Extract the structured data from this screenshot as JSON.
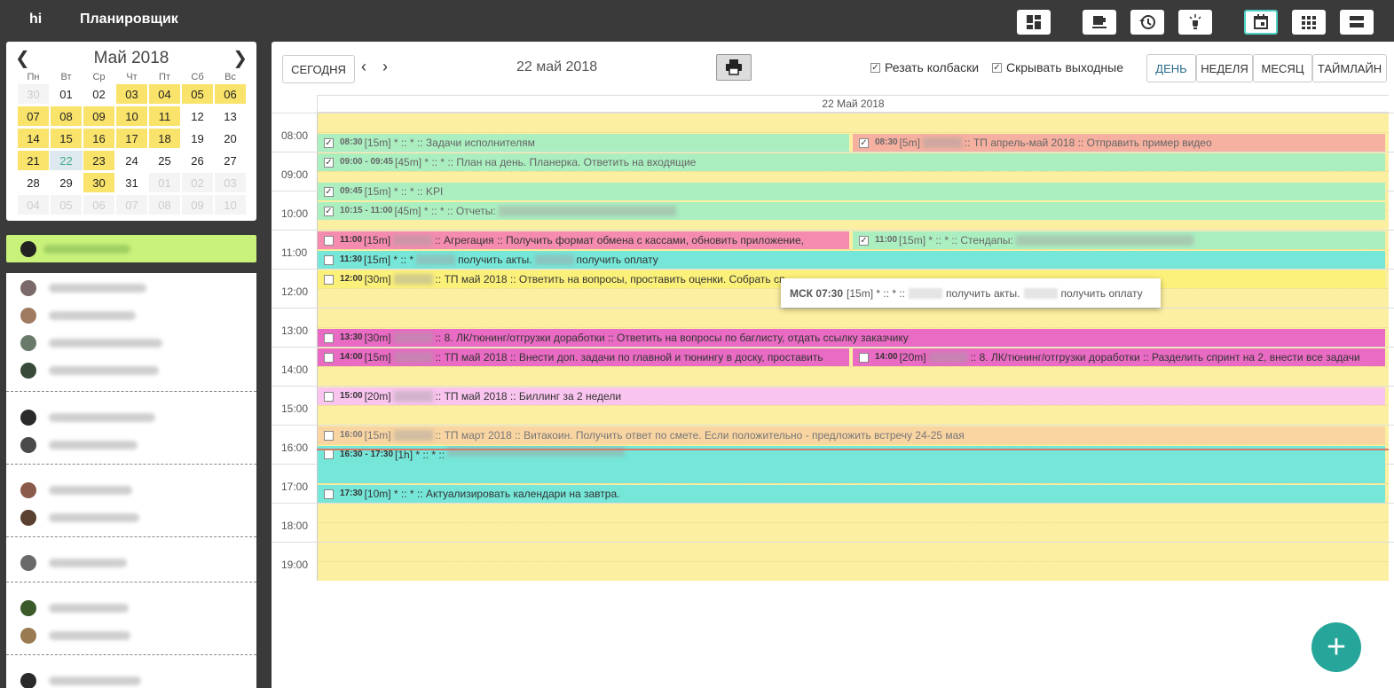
{
  "topbar": {
    "brand": "hi",
    "title": "Планировщик",
    "buttons": [
      {
        "name": "dashboard-icon",
        "glyph": "dashboard"
      },
      {
        "name": "coffee-icon",
        "glyph": "coffee"
      },
      {
        "name": "history-icon",
        "glyph": "history"
      },
      {
        "name": "lightbulb-icon",
        "glyph": "light"
      },
      {
        "name": "calendar-day-icon",
        "glyph": "calendar",
        "active": true
      },
      {
        "name": "grid-view-icon",
        "glyph": "grid"
      },
      {
        "name": "list-view-icon",
        "glyph": "list"
      }
    ]
  },
  "minical": {
    "month": "Май 2018",
    "weekdays": [
      "Пн",
      "Вт",
      "Ср",
      "Чт",
      "Пт",
      "Сб",
      "Вс"
    ],
    "weeks": [
      [
        {
          "d": "30",
          "t": "other"
        },
        {
          "d": "01",
          "t": ""
        },
        {
          "d": "02",
          "t": ""
        },
        {
          "d": "03",
          "t": "hl"
        },
        {
          "d": "04",
          "t": "hl"
        },
        {
          "d": "05",
          "t": "hl"
        },
        {
          "d": "06",
          "t": "hl"
        }
      ],
      [
        {
          "d": "07",
          "t": "hl"
        },
        {
          "d": "08",
          "t": "hl"
        },
        {
          "d": "09",
          "t": "hl"
        },
        {
          "d": "10",
          "t": "hl"
        },
        {
          "d": "11",
          "t": "hl"
        },
        {
          "d": "12",
          "t": ""
        },
        {
          "d": "13",
          "t": ""
        }
      ],
      [
        {
          "d": "14",
          "t": "hl"
        },
        {
          "d": "15",
          "t": "hl"
        },
        {
          "d": "16",
          "t": "hl"
        },
        {
          "d": "17",
          "t": "hl"
        },
        {
          "d": "18",
          "t": "hl"
        },
        {
          "d": "19",
          "t": ""
        },
        {
          "d": "20",
          "t": ""
        }
      ],
      [
        {
          "d": "21",
          "t": "hl"
        },
        {
          "d": "22",
          "t": "today"
        },
        {
          "d": "23",
          "t": "hl"
        },
        {
          "d": "24",
          "t": ""
        },
        {
          "d": "25",
          "t": ""
        },
        {
          "d": "26",
          "t": ""
        },
        {
          "d": "27",
          "t": ""
        }
      ],
      [
        {
          "d": "28",
          "t": ""
        },
        {
          "d": "29",
          "t": ""
        },
        {
          "d": "30",
          "t": "hl"
        },
        {
          "d": "31",
          "t": ""
        },
        {
          "d": "01",
          "t": "other"
        },
        {
          "d": "02",
          "t": "other"
        },
        {
          "d": "03",
          "t": "other"
        }
      ],
      [
        {
          "d": "04",
          "t": "other"
        },
        {
          "d": "05",
          "t": "other"
        },
        {
          "d": "06",
          "t": "other"
        },
        {
          "d": "07",
          "t": "other"
        },
        {
          "d": "08",
          "t": "other"
        },
        {
          "d": "09",
          "t": "other"
        },
        {
          "d": "10",
          "t": "other"
        }
      ]
    ]
  },
  "toolbar": {
    "today_label": "СЕГОДНЯ",
    "current_date": "22 май 2018",
    "cut_sausages_label": "Резать колбаски",
    "hide_weekends_label": "Скрывать выходные",
    "view_day": "ДЕНЬ",
    "view_week": "НЕДЕЛЯ",
    "view_month": "МЕСЯЦ",
    "view_timeline": "ТАЙМЛАЙН"
  },
  "calendar": {
    "column_header": "22 Май 2018",
    "hours": [
      "08:00",
      "09:00",
      "10:00",
      "11:00",
      "12:00",
      "13:00",
      "14:00",
      "15:00",
      "16:00",
      "17:00",
      "18:00",
      "19:00"
    ]
  },
  "events": [
    {
      "id": "e1",
      "done": true,
      "time": "08:30",
      "text": "[15m] * :: * :: Задачи исполнителям",
      "blur": false,
      "color": "#abeec0",
      "col": "left"
    },
    {
      "id": "e2",
      "done": true,
      "time": "08:30",
      "text": "[5m]",
      "text2": ":: ТП апрель-май 2018 :: Отправить пример видео",
      "blur": true,
      "color": "#f5b0a0",
      "col": "right"
    },
    {
      "id": "e3",
      "done": true,
      "time": "09:00 - 09:45",
      "text": "[45m] * :: * :: План на день. Планерка. Ответить на входящие",
      "blur": false,
      "color": "#abeec0",
      "col": "full"
    },
    {
      "id": "e4",
      "done": true,
      "time": "09:45",
      "text": "[15m] * :: * :: KPI",
      "blur": false,
      "color": "#abeec0",
      "col": "full"
    },
    {
      "id": "e5",
      "done": true,
      "time": "10:15 - 11:00",
      "text": "[45m] * :: * :: Отчеты:",
      "blur": true,
      "color": "#abeec0",
      "col": "full"
    },
    {
      "id": "e6",
      "done": false,
      "time": "11:00",
      "text": "[15m]",
      "text2": ":: Агрегация :: Получить формат обмена с кассами, обновить приложение,",
      "blur": true,
      "color": "#f58cb0",
      "col": "left"
    },
    {
      "id": "e7",
      "done": true,
      "time": "11:00",
      "text": "[15m] * :: * :: Стендапы:",
      "blur": true,
      "color": "#abeec0",
      "col": "right"
    },
    {
      "id": "e8",
      "done": false,
      "time": "11:30",
      "text": "[15m] * :: *",
      "text2": "получить акты.",
      "text3": "получить оплату",
      "blur": true,
      "color": "#76e6d8",
      "col": "full"
    },
    {
      "id": "e9",
      "done": false,
      "time": "12:00",
      "text": "[30m]",
      "text2": ":: ТП май 2018 :: Ответить на вопросы, проставить оценки. Собрать сп",
      "blur": true,
      "color": "#fbf07a",
      "col": "full"
    },
    {
      "id": "e10",
      "done": false,
      "time": "13:30",
      "text": "[30m]",
      "text2": ":: 8. ЛК/тюнинг/отгрузки доработки :: Ответить на вопросы по баглисту, отдать ссылку заказчику",
      "blur": true,
      "color": "#e96bc3",
      "col": "full"
    },
    {
      "id": "e11",
      "done": false,
      "time": "14:00",
      "text": "[15m]",
      "text2": ":: ТП май 2018 :: Внести доп. задачи по главной и тюнингу в доску, проставить",
      "blur": true,
      "color": "#e96bc3",
      "col": "left"
    },
    {
      "id": "e12",
      "done": false,
      "time": "14:00",
      "text": "[20m]",
      "text2": ":: 8. ЛК/тюнинг/отгрузки доработки :: Разделить спринт на 2, внести все задачи",
      "blur": true,
      "color": "#e96bc3",
      "col": "right"
    },
    {
      "id": "e13",
      "done": false,
      "time": "15:00",
      "text": "[20m]",
      "text2": ":: ТП май 2018 :: Биллинг за 2 недели",
      "blur": true,
      "color": "#f9c4ee",
      "col": "full"
    },
    {
      "id": "e14",
      "done": false,
      "time": "16:00",
      "text": "[15m]",
      "text2": ":: ТП март 2018 :: Витакоин. Получить ответ по смете. Если положительно - предложить встречу 24-25 мая",
      "blur": true,
      "color": "#f9d5a2",
      "col": "full",
      "faded": true
    },
    {
      "id": "e15",
      "done": false,
      "time": "16:30 - 17:30",
      "text": "[1h] * :: * ::",
      "blur": true,
      "color": "#76e6d8",
      "col": "full"
    },
    {
      "id": "e16",
      "done": false,
      "time": "17:30",
      "text": "[10m] * :: * :: Актуализировать календари на завтра.",
      "blur": false,
      "color": "#76e6d8",
      "col": "full"
    }
  ],
  "tooltip": {
    "prefix": "МСК 07:30",
    "duration": "[15m] * :: * ::",
    "part1": "получить акты.",
    "part2": "получить оплату"
  },
  "fab": {
    "label": "+"
  }
}
